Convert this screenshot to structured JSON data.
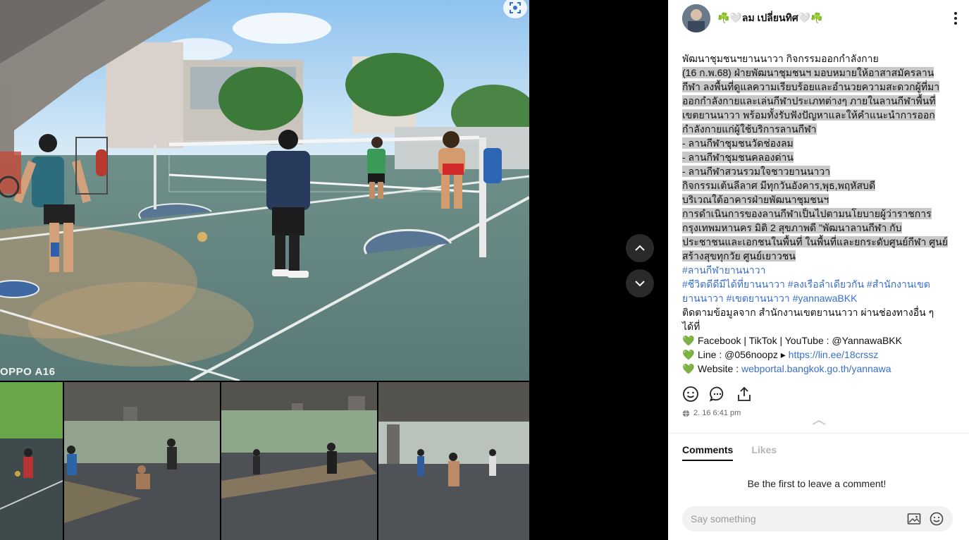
{
  "viewer": {
    "watermark": "OPPO A16",
    "nav": {
      "up_icon": "chevron-up-icon",
      "down_icon": "chevron-down-icon"
    },
    "lens_icon": "visual-search-icon"
  },
  "post": {
    "author": "☘️🤍ลม เปลี่ยนทิศ🤍☘️",
    "title": "พัฒนาชุมชนฯยานนาวา กิจกรรมออกกำลังกาย",
    "lines": [
      " (16 ก.พ.68)  ฝ่ายพัฒนาชุมชนฯ มอบหมายให้อาสาสมัครลาน",
      "กีฬา ลงพื้นที่ดูแลความเรียบร้อยและอำนวยความสะดวกผู้ที่มา",
      "ออกกำลังกายและเล่นกีฬาประเภทต่างๆ ภายในลานกีฬาพื้นที่",
      "เขตยานนาวา พร้อมทั้งรับฟังปัญหาและให้คำแนะนำการออก",
      "กำลังกายแก่ผู้ใช้บริการลานกีฬา",
      "- ลานกีฬาชุมชนวัดช่องลม",
      "- ลานกีฬาชุมชนคลองด่าน",
      "- ลานกีฬาสวนรวมใจชาวยานนาวา",
      "กิจกรรมเต้นลีลาศ มีทุกวันอังคาร,พุธ,พฤหัสบดี",
      "บริเวณใต้อาคารฝ่ายพัฒนาชุมชนฯ",
      "   การดำเนินการของลานกีฬาเป็นไปตามนโยบายผู้ว่าราชการ",
      "กรุงเทพมหานคร  มิติ 2 สุขภาพดี  \"พัฒนาลานกีฬา กับ",
      "ประชาชนและเอกชนในพื้นที่ ในพื้นที่และยกระดับศูนย์กีฬา ศูนย์",
      "สร้างสุขทุกวัย ศูนย์เยาวชน"
    ],
    "hashtags_1": "#ลานกีฬายานนาวา",
    "hashtags_2": "#ชีวิตดีดีมีได้ที่ยานนาวา #ลงเรือลำเดียวกัน #สำนักงานเขต",
    "hashtags_3": "ยานนาวา #เขตยานนาวา #yannawaBKK",
    "follow_1": "ติดตามข้อมูลจาก สำนักงานเขตยานนาวา ผ่านช่องทางอื่น ๆ",
    "follow_2": "ได้ที่",
    "heart_icon": "💚",
    "contact_facebook": "Facebook | TikTok | YouTube : @YannawaBKK",
    "contact_line_prefix": "Line : @056noopz ▸ ",
    "contact_line_link": "https://lin.ee/18crssz",
    "contact_website_prefix": "Website : ",
    "contact_website_link": "webportal.bangkok.go.th/yannawa",
    "timestamp": "2. 16 6:41 pm"
  },
  "actions": {
    "react_icon": "smiley-icon",
    "comment_icon": "comment-bubble-icon",
    "share_icon": "share-icon"
  },
  "comments": {
    "tab_comments": "Comments",
    "tab_likes": "Likes",
    "empty_text": "Be the first to leave a comment!",
    "input_placeholder": "Say something",
    "image_icon": "image-icon",
    "emoji_icon": "emoji-icon"
  }
}
